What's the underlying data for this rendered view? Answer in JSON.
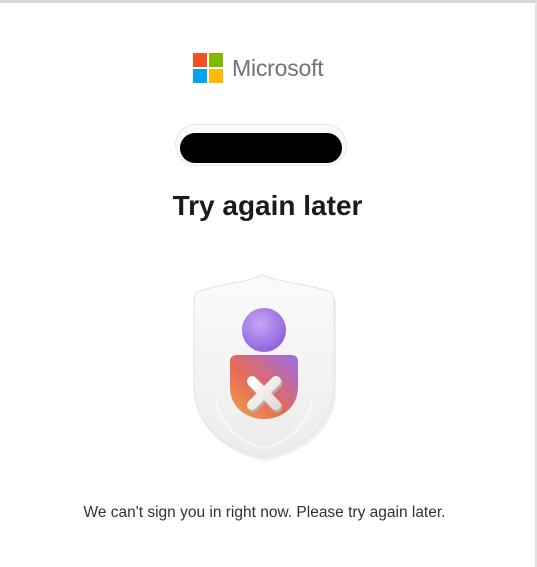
{
  "brand": {
    "name": "Microsoft",
    "logo_icon": "microsoft-logo-icon",
    "logo_colors": [
      "#f25022",
      "#7fba00",
      "#00a4ef",
      "#ffb900"
    ]
  },
  "account": {
    "redacted": true
  },
  "page": {
    "title": "Try again later",
    "message": "We can't sign you in right now. Please try again later."
  },
  "illustration": {
    "icon": "shield-user-error-icon",
    "colors": {
      "shield": "#f4f4f4",
      "head": "#a276e3",
      "body_start": "#f08a3c",
      "body_end": "#9b6fe8"
    }
  }
}
